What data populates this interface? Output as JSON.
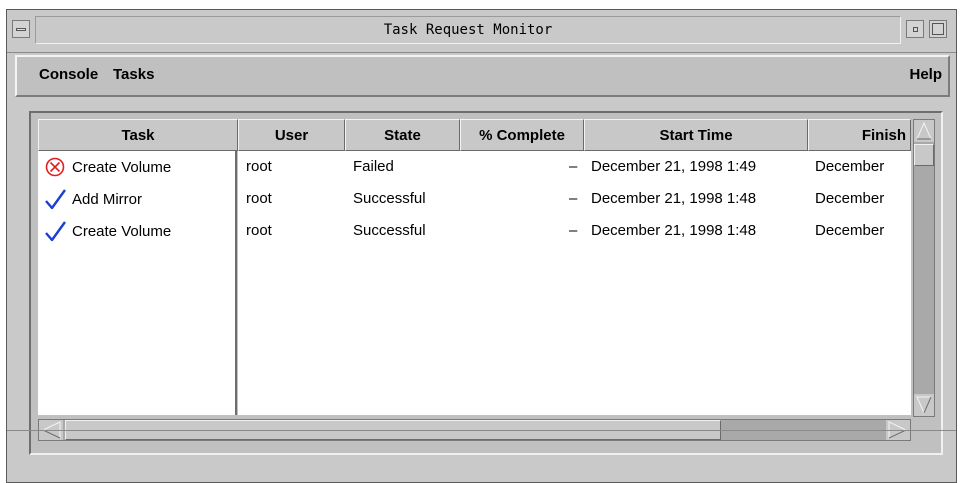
{
  "window": {
    "title": "Task Request Monitor"
  },
  "menubar": {
    "items": [
      "Console",
      "Tasks"
    ],
    "help": "Help"
  },
  "columns": {
    "task": "Task",
    "user": "User",
    "state": "State",
    "percent": "% Complete",
    "start": "Start Time",
    "finish": "Finish"
  },
  "rows": [
    {
      "icon": "failed-circle-x-icon",
      "task": "Create Volume",
      "user": "root",
      "state": "Failed",
      "percent": "–",
      "start": "December 21, 1998 1:49",
      "finish": "December"
    },
    {
      "icon": "success-checkmark-icon",
      "task": "Add Mirror",
      "user": "root",
      "state": "Successful",
      "percent": "–",
      "start": "December 21, 1998 1:48",
      "finish": "December"
    },
    {
      "icon": "success-checkmark-icon",
      "task": "Create Volume",
      "user": "root",
      "state": "Successful",
      "percent": "–",
      "start": "December 21, 1998 1:48",
      "finish": "December"
    }
  ],
  "colors": {
    "failed": "#e02020",
    "success": "#1a3fd6",
    "window_bg": "#c9c9c9"
  }
}
